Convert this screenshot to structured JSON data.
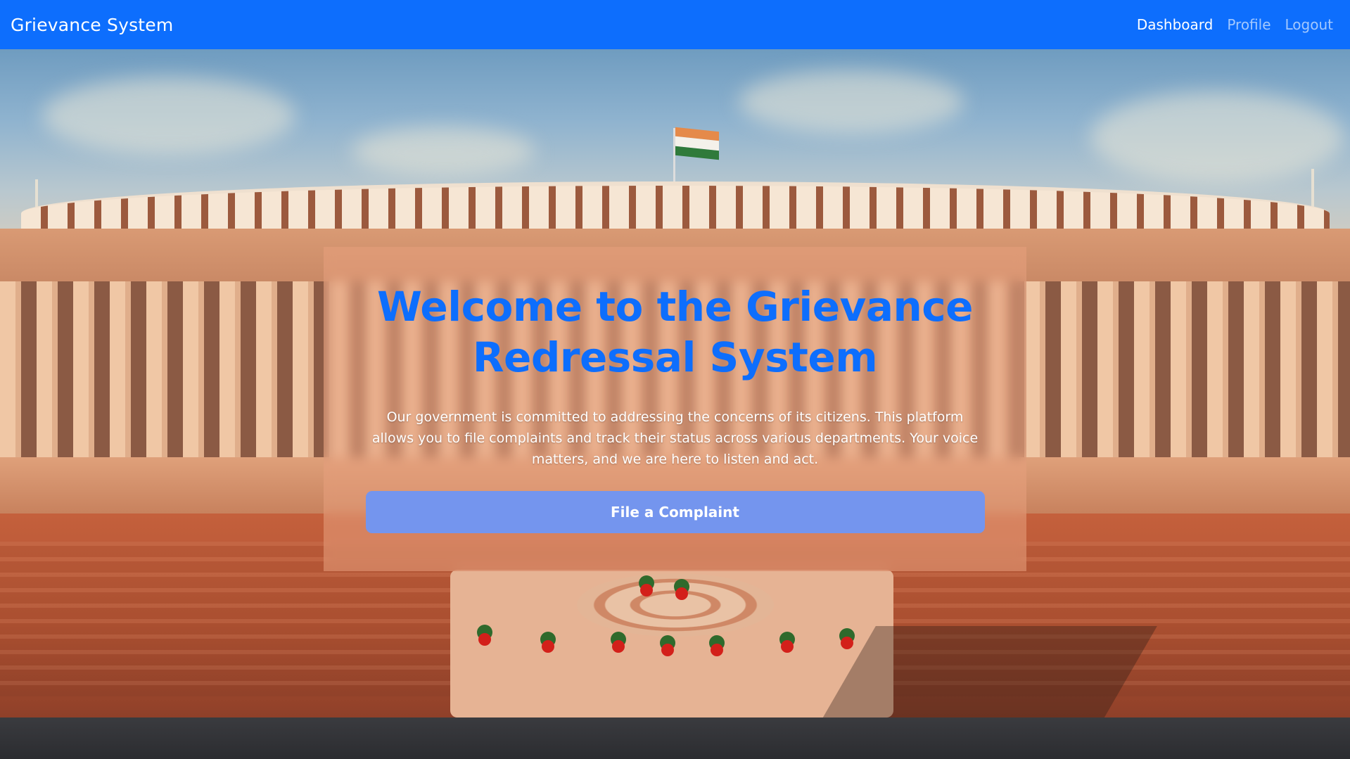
{
  "navbar": {
    "brand": "Grievance System",
    "links": [
      {
        "label": "Dashboard",
        "active": true
      },
      {
        "label": "Profile",
        "active": false
      },
      {
        "label": "Logout",
        "active": false
      }
    ]
  },
  "hero": {
    "title": "Welcome to the Grievance Redressal System",
    "description": "Our government is committed to addressing the concerns of its citizens. This platform allows you to file complaints and track their status across various departments. Your voice matters, and we are here to listen and act.",
    "cta_label": "File a Complaint"
  },
  "colors": {
    "primary": "#0d6efd",
    "button": "#7495ee",
    "hero_text": "#ffffff"
  }
}
